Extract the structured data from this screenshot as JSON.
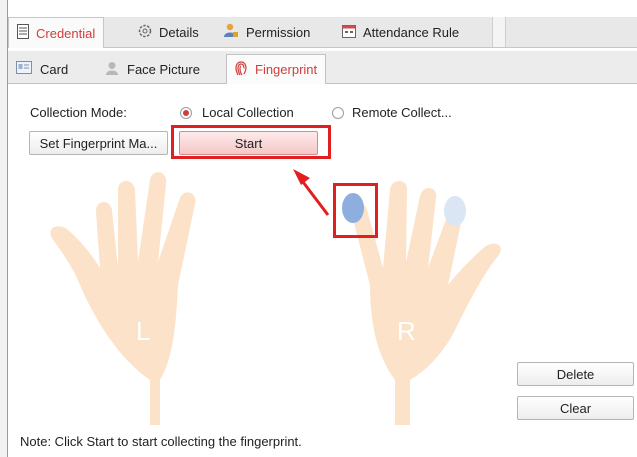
{
  "main_tabs": [
    {
      "label": "Credential",
      "icon": "credential-icon",
      "active": true
    },
    {
      "label": "Details",
      "icon": "details-icon",
      "active": false
    },
    {
      "label": "Permission",
      "icon": "permission-icon",
      "active": false
    },
    {
      "label": "Attendance Rule",
      "icon": "attendance-icon",
      "active": false
    }
  ],
  "sub_tabs": [
    {
      "label": "Card",
      "icon": "card-icon",
      "active": false
    },
    {
      "label": "Face Picture",
      "icon": "face-icon",
      "active": false
    },
    {
      "label": "Fingerprint",
      "icon": "fingerprint-icon",
      "active": true
    }
  ],
  "collection": {
    "label": "Collection Mode:",
    "options": [
      {
        "label": "Local Collection",
        "selected": true
      },
      {
        "label": "Remote Collect...",
        "selected": false
      }
    ]
  },
  "buttons": {
    "set_fingerprint": "Set Fingerprint Ma...",
    "start": "Start",
    "delete": "Delete",
    "clear": "Clear"
  },
  "hands": {
    "left_label": "L",
    "right_label": "R"
  },
  "note": "Note: Click Start to start collecting the fingerprint.",
  "colors": {
    "accent": "#d23c3c",
    "highlight": "#e02020",
    "hand": "#fbe2c8",
    "finger_selected": "#8faee0",
    "finger_light": "#dbe6f5"
  }
}
